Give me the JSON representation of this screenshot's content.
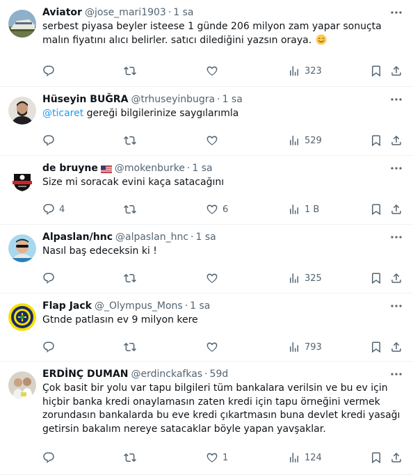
{
  "tweets": [
    {
      "name": "Aviator",
      "handle": "@jose_mari1903",
      "time": "1 sa",
      "text": "serbest piyasa beyler isteese 1 günde 206 milyon zam yapar sonuçta malın fiyatını alıcı belirler. satıcı dilediğini yazsın oraya.",
      "emoji": "smiling-face-emoji",
      "replies": "",
      "reposts": "",
      "likes": "",
      "views": "323"
    },
    {
      "name": "Hüseyin BUĞRA",
      "handle": "@trhuseyinbugra",
      "time": "1 sa",
      "mention": "@ticaret",
      "text": " gereği bilgilerinize saygılarımla",
      "replies": "",
      "reposts": "",
      "likes": "",
      "views": "529"
    },
    {
      "name": "de bruyne",
      "flag": "us-flag-emoji",
      "handle": "@mokenburke",
      "time": "1 sa",
      "text": "Size mi soracak evini kaça satacağını",
      "replies": "4",
      "reposts": "",
      "likes": "6",
      "views": "1 B"
    },
    {
      "name": "Alpaslan/hnc",
      "handle": "@alpaslan_hnc",
      "time": "1 sa",
      "text": "Nasıl baş edeceksin ki !",
      "replies": "",
      "reposts": "",
      "likes": "",
      "views": "325"
    },
    {
      "name": "Flap Jack",
      "handle": "@_Olympus_Mons",
      "time": "1 sa",
      "text": "Gtnde patlasın ev 9 milyon kere",
      "replies": "",
      "reposts": "",
      "likes": "",
      "views": "793"
    },
    {
      "name": "ERDİNÇ DUMAN",
      "handle": "@erdinckafkas",
      "time": "59d",
      "text": "Çok basit bir yolu var tapu bilgileri tüm bankalara verilsin ve bu ev için hiçbir banka kredi onaylamasın zaten kredi için tapu örneğini vermek zorundasın bankalarda bu eve kredi çıkartmasın buna devlet kredi yasağı getirsin bakalım nereye satacaklar böyle yapan yavşaklar.",
      "replies": "",
      "reposts": "",
      "likes": "1",
      "views": "124"
    }
  ],
  "colors": {
    "text": "#0f1419",
    "secondary": "#536471",
    "link": "#1d9bf0",
    "divider": "#eff3f4"
  },
  "separator": "·"
}
